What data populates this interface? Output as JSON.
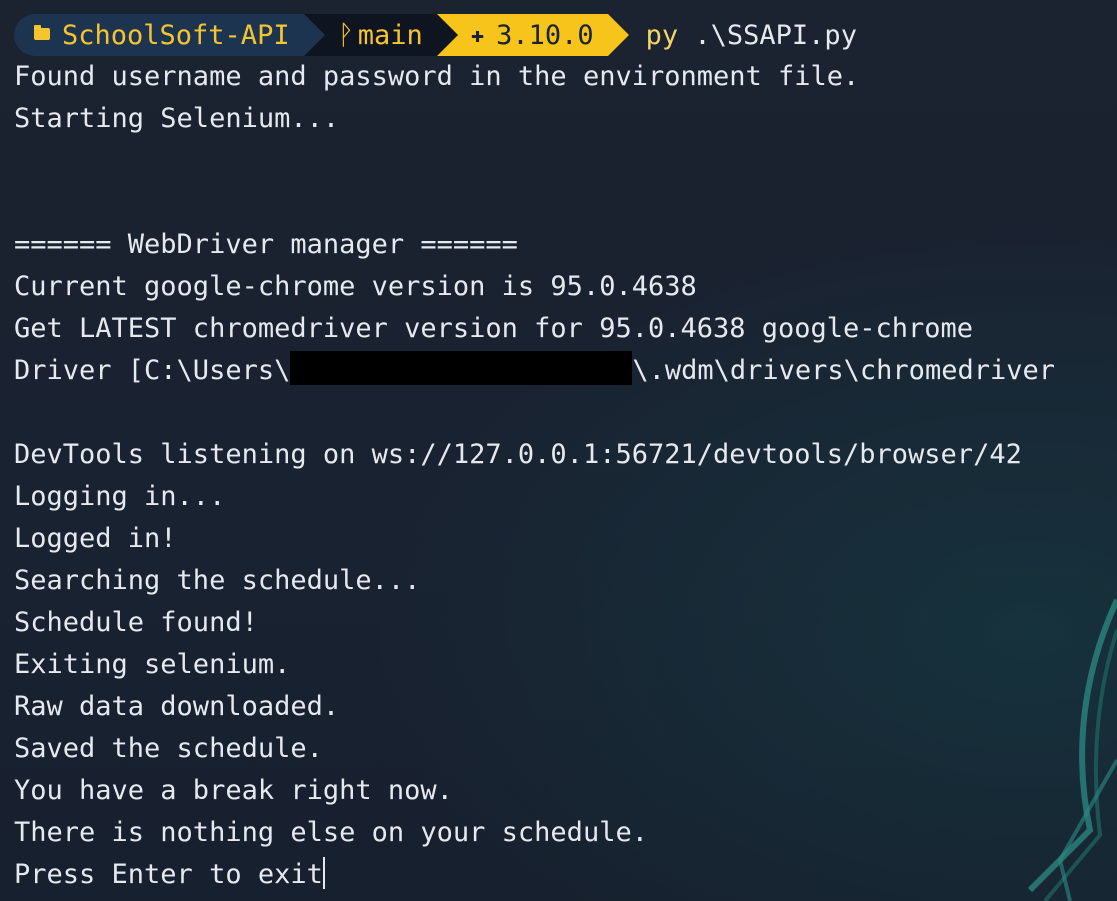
{
  "window": {
    "background_color": "#1a2230",
    "text_color": "#e6e9ee"
  },
  "prompt": {
    "folder_icon": "folder-icon",
    "folder": "SchoolSoft-API",
    "branch_icon": "git-branch-icon",
    "branch": "main",
    "python_icon": "python-icon",
    "python_version": "3.10.0",
    "command": "py",
    "command_arg": ".\\SSAPI.py",
    "colors": {
      "folder_bg": "#1d3450",
      "folder_fg": "#f5c530",
      "git_bg": "#0f1520",
      "python_bg": "#f6c41a"
    }
  },
  "output": {
    "lines": [
      "Found username and password in the environment file.",
      "Starting Selenium...",
      "",
      "",
      "====== WebDriver manager ======",
      "Current google-chrome version is 95.0.4638",
      "Get LATEST chromedriver version for 95.0.4638 google-chrome"
    ],
    "driver_line_prefix": "Driver [C:\\Users\\",
    "driver_line_suffix": "\\.wdm\\drivers\\chromedriver",
    "lines_after": [
      "",
      "DevTools listening on ws://127.0.0.1:56721/devtools/browser/42",
      "Logging in...",
      "Logged in!",
      "Searching the schedule...",
      "Schedule found!",
      "Exiting selenium.",
      "Raw data downloaded.",
      "Saved the schedule.",
      "You have a break right now.",
      "There is nothing else on your schedule."
    ],
    "final_prompt": "Press Enter to exit"
  }
}
